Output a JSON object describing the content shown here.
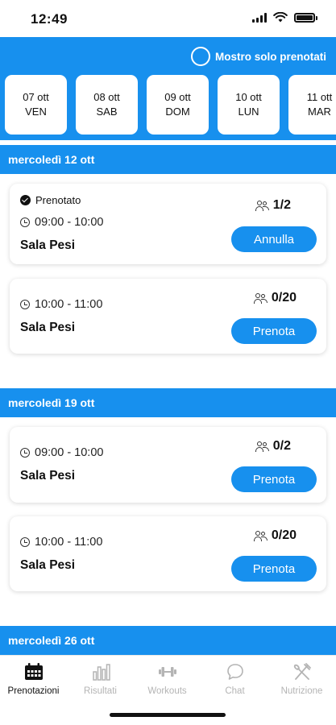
{
  "status_bar": {
    "time": "12:49"
  },
  "header": {
    "only_booked_label": "Mostro solo prenotati",
    "days": [
      {
        "date": "07 ott",
        "weekday": "VEN"
      },
      {
        "date": "08 ott",
        "weekday": "SAB"
      },
      {
        "date": "09 ott",
        "weekday": "DOM"
      },
      {
        "date": "10 ott",
        "weekday": "LUN"
      },
      {
        "date": "11 ott",
        "weekday": "MAR"
      }
    ]
  },
  "sections": [
    {
      "title": "mercoledì 12 ott",
      "slots": [
        {
          "booked_label": "Prenotato",
          "time": "09:00 - 10:00",
          "room": "Sala Pesi",
          "count": "1/2",
          "action": "Annulla"
        },
        {
          "time": "10:00 - 11:00",
          "room": "Sala Pesi",
          "count": "0/20",
          "action": "Prenota"
        }
      ]
    },
    {
      "title": "mercoledì 19 ott",
      "slots": [
        {
          "time": "09:00 - 10:00",
          "room": "Sala Pesi",
          "count": "0/2",
          "action": "Prenota"
        },
        {
          "time": "10:00 - 11:00",
          "room": "Sala Pesi",
          "count": "0/20",
          "action": "Prenota"
        }
      ]
    },
    {
      "title": "mercoledì 26 ott",
      "slots": []
    }
  ],
  "tab_bar": {
    "tabs": [
      {
        "label": "Prenotazioni",
        "icon": "calendar-icon",
        "active": true
      },
      {
        "label": "Risultati",
        "icon": "bar-chart-icon",
        "active": false
      },
      {
        "label": "Workouts",
        "icon": "dumbbell-icon",
        "active": false
      },
      {
        "label": "Chat",
        "icon": "chat-bubble-icon",
        "active": false
      },
      {
        "label": "Nutrizione",
        "icon": "fork-knife-icon",
        "active": false
      }
    ]
  },
  "colors": {
    "accent": "#1790ee",
    "tab_inactive": "#b4b4b4"
  }
}
